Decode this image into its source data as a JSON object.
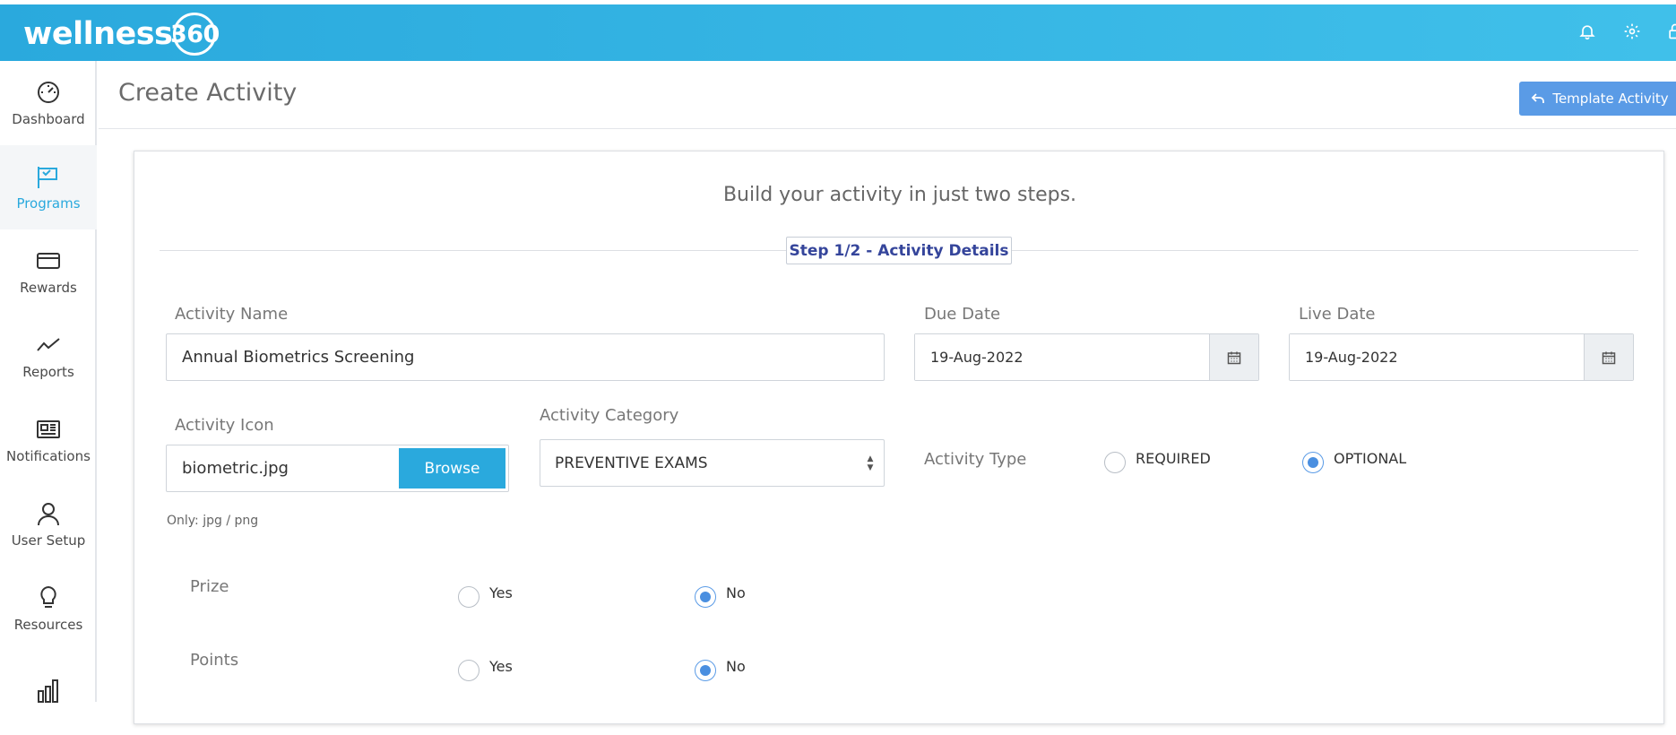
{
  "brand": {
    "logo_text": "wellness",
    "logo_number": "360"
  },
  "topbar": {
    "icons": [
      "bell-icon",
      "gear-icon",
      "lock-icon"
    ]
  },
  "sidebar": {
    "items": [
      {
        "label": "Dashboard",
        "icon": "speedometer-icon",
        "active": false
      },
      {
        "label": "Programs",
        "icon": "flag-icon",
        "active": true
      },
      {
        "label": "Rewards",
        "icon": "credit-card-icon",
        "active": false
      },
      {
        "label": "Reports",
        "icon": "trend-line-icon",
        "active": false
      },
      {
        "label": "Notifications",
        "icon": "newspaper-icon",
        "active": false
      },
      {
        "label": "User Setup",
        "icon": "user-icon",
        "active": false
      },
      {
        "label": "Resources",
        "icon": "lightbulb-icon",
        "active": false
      },
      {
        "label": "",
        "icon": "bar-chart-icon",
        "active": false
      }
    ]
  },
  "header": {
    "title": "Create Activity",
    "template_button": "Template Activity"
  },
  "card": {
    "heading": "Build your activity in just two steps.",
    "step": "Step 1/2 - Activity Details"
  },
  "form": {
    "activity_name_label": "Activity Name",
    "activity_name_value": "Annual Biometrics Screening",
    "due_date_label": "Due Date",
    "due_date_value": "19-Aug-2022",
    "live_date_label": "Live Date",
    "live_date_value": "19-Aug-2022",
    "activity_icon_label": "Activity Icon",
    "activity_icon_file": "biometric.jpg",
    "browse_label": "Browse",
    "icon_hint": "Only: jpg / png",
    "activity_category_label": "Activity Category",
    "activity_category_value": "PREVENTIVE EXAMS",
    "activity_type_label": "Activity Type",
    "activity_type_options": [
      "REQUIRED",
      "OPTIONAL"
    ],
    "activity_type_selected": "OPTIONAL",
    "prize_label": "Prize",
    "prize_options": [
      "Yes",
      "No"
    ],
    "prize_selected": "No",
    "points_label": "Points",
    "points_options": [
      "Yes",
      "No"
    ],
    "points_selected": "No"
  },
  "colors": {
    "brand": "#2aa9dd",
    "accent_button": "#5a9be6",
    "step_text": "#35459b"
  }
}
